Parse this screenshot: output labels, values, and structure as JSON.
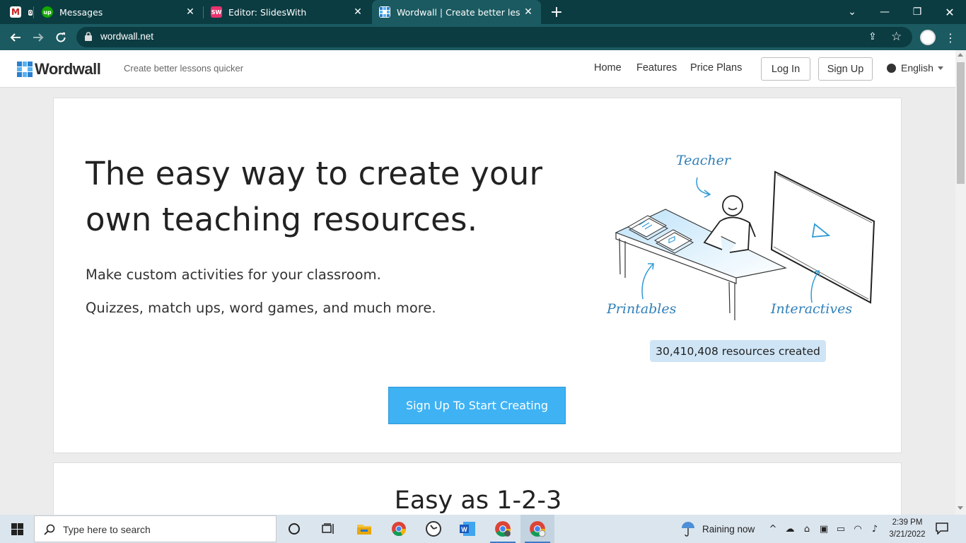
{
  "browser": {
    "tabs": [
      {
        "label": "",
        "favicon": "gmail-icon",
        "badge": "0"
      },
      {
        "label": "Messages",
        "favicon": "upwork-icon"
      },
      {
        "label": "Editor: SlidesWith",
        "favicon": "slideswith-icon"
      },
      {
        "label": "Wordwall | Create better lessons",
        "favicon": "wordwall-icon",
        "active": true
      }
    ],
    "new_tab": "+",
    "url": "wordwall.net"
  },
  "site": {
    "logo_text": "Wordwall",
    "tagline": "Create better lessons quicker",
    "nav": {
      "home": "Home",
      "features": "Features",
      "price_plans": "Price Plans"
    },
    "login": "Log In",
    "signup": "Sign Up",
    "language": "English"
  },
  "hero": {
    "title_line1": "The easy way to create your",
    "title_line2": "own teaching resources.",
    "sub1": "Make custom activities for your classroom.",
    "sub2": "Quizzes, match ups, word games, and much more.",
    "illustration": {
      "label_teacher": "Teacher",
      "label_printables": "Printables",
      "label_interactives": "Interactives"
    },
    "counter": "30,410,408 resources created",
    "cta": "Sign Up To Start Creating"
  },
  "section2": {
    "title": "Easy as 1-2-3"
  },
  "taskbar": {
    "search_placeholder": "Type here to search",
    "weather": "Raining now",
    "time": "2:39 PM",
    "date": "3/21/2022",
    "apps": [
      "task-view-icon",
      "file-explorer-icon",
      "chrome-icon",
      "clock-app-icon",
      "word-icon",
      "chrome-profile-icon",
      "chrome-active-icon"
    ]
  },
  "colors": {
    "tab_strip": "#0b3c42",
    "toolbar": "#1b5a61",
    "cta": "#3fb2f3",
    "counter_bg": "#cfe5f6",
    "illustration_accent": "#2f9bd6"
  }
}
